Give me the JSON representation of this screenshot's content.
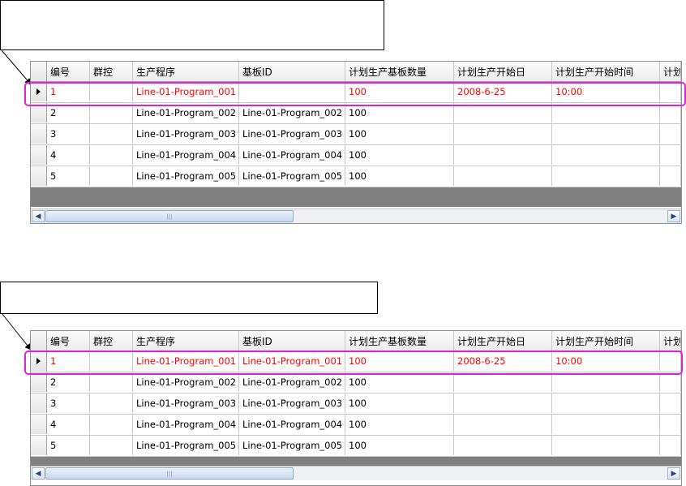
{
  "columns": [
    {
      "key": "id",
      "label": "编号"
    },
    {
      "key": "group",
      "label": "群控"
    },
    {
      "key": "program",
      "label": "生产程序"
    },
    {
      "key": "board",
      "label": "基板ID"
    },
    {
      "key": "qty",
      "label": "计划生产基板数量"
    },
    {
      "key": "date",
      "label": "计划生产开始日"
    },
    {
      "key": "time",
      "label": "计划生产开始时间"
    },
    {
      "key": "more",
      "label": "计划"
    }
  ],
  "grids": [
    {
      "rows": [
        {
          "id": "1",
          "group": "",
          "program": "Line-01-Program_001",
          "board": "",
          "qty": "100",
          "date": "2008-6-25",
          "time": "10:00",
          "selected": true
        },
        {
          "id": "2",
          "group": "",
          "program": "Line-01-Program_002",
          "board": "Line-01-Program_002",
          "qty": "100",
          "date": "",
          "time": ""
        },
        {
          "id": "3",
          "group": "",
          "program": "Line-01-Program_003",
          "board": "Line-01-Program_003",
          "qty": "100",
          "date": "",
          "time": ""
        },
        {
          "id": "4",
          "group": "",
          "program": "Line-01-Program_004",
          "board": "Line-01-Program_004",
          "qty": "100",
          "date": "",
          "time": ""
        },
        {
          "id": "5",
          "group": "",
          "program": "Line-01-Program_005",
          "board": "Line-01-Program_005",
          "qty": "100",
          "date": "",
          "time": ""
        }
      ]
    },
    {
      "rows": [
        {
          "id": "1",
          "group": "",
          "program": "Line-01-Program_001",
          "board": "Line-01-Program_001",
          "qty": "100",
          "date": "2008-6-25",
          "time": "10:00",
          "selected": true
        },
        {
          "id": "2",
          "group": "",
          "program": "Line-01-Program_002",
          "board": "Line-01-Program_002",
          "qty": "100",
          "date": "",
          "time": ""
        },
        {
          "id": "3",
          "group": "",
          "program": "Line-01-Program_003",
          "board": "Line-01-Program_003",
          "qty": "100",
          "date": "",
          "time": ""
        },
        {
          "id": "4",
          "group": "",
          "program": "Line-01-Program_004",
          "board": "Line-01-Program_004",
          "qty": "100",
          "date": "",
          "time": ""
        },
        {
          "id": "5",
          "group": "",
          "program": "Line-01-Program_005",
          "board": "Line-01-Program_005",
          "qty": "100",
          "date": "",
          "time": ""
        }
      ]
    }
  ],
  "colors": {
    "selected_text": "#ff0000",
    "highlight": "#e020e0",
    "filler": "#808080"
  },
  "icons": {
    "row_indicator": "current-row-arrow-icon",
    "scroll_left": "scroll-left-icon",
    "scroll_right": "scroll-right-icon"
  }
}
